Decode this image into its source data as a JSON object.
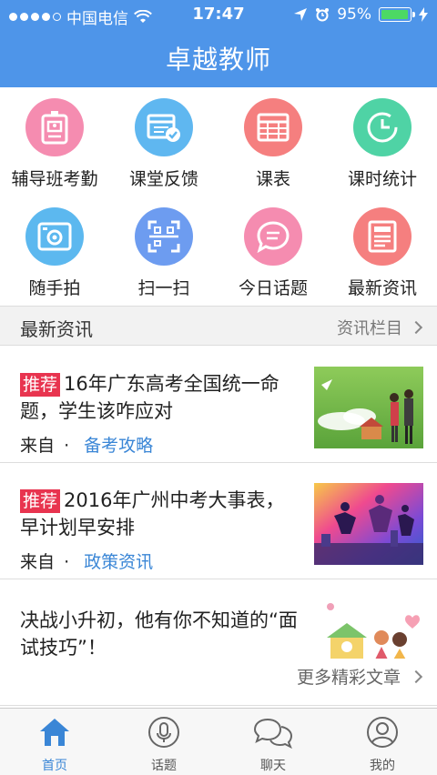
{
  "status_bar": {
    "carrier": "中国电信",
    "time": "17:47",
    "battery": "95%",
    "battery_level": 0.95
  },
  "header": {
    "title": "卓越教师"
  },
  "colors": {
    "brand": "#4e95e9",
    "tag": "#e8344f",
    "link": "#3a86d6"
  },
  "functions": [
    {
      "label": "辅导班考勤",
      "icon": "badge-icon",
      "color": "#f58cb0"
    },
    {
      "label": "课堂反馈",
      "icon": "feedback-icon",
      "color": "#5fb7f0"
    },
    {
      "label": "课表",
      "icon": "calendar-icon",
      "color": "#f57f7f"
    },
    {
      "label": "课时统计",
      "icon": "clock-icon",
      "color": "#4fd3a5"
    },
    {
      "label": "随手拍",
      "icon": "camera-icon",
      "color": "#5cb8ef"
    },
    {
      "label": "扫一扫",
      "icon": "scan-icon",
      "color": "#6d9cf0"
    },
    {
      "label": "今日话题",
      "icon": "chat-bubble-icon",
      "color": "#f58cb0"
    },
    {
      "label": "最新资讯",
      "icon": "news-icon",
      "color": "#f57f7f"
    }
  ],
  "news_section": {
    "title": "最新资讯",
    "more_label": "资讯栏目"
  },
  "news": [
    {
      "tag": "推荐",
      "title": "16年广东高考全国统一命题，学生该咋应对",
      "from_label": "来自",
      "separator": "·",
      "category": "备考攻略"
    },
    {
      "tag": "推荐",
      "title": "2016年广州中考大事表，早计划早安排",
      "from_label": "来自",
      "separator": "·",
      "category": "政策资讯"
    },
    {
      "tag": "",
      "title": "决战小升初，他有你不知道的“面试技巧”！"
    }
  ],
  "more_articles": "更多精彩文章",
  "tabs": [
    {
      "label": "首页",
      "icon": "home-icon",
      "active": true
    },
    {
      "label": "话题",
      "icon": "microphone-icon",
      "active": false
    },
    {
      "label": "聊天",
      "icon": "chat-icon",
      "active": false
    },
    {
      "label": "我的",
      "icon": "profile-icon",
      "active": false
    }
  ]
}
